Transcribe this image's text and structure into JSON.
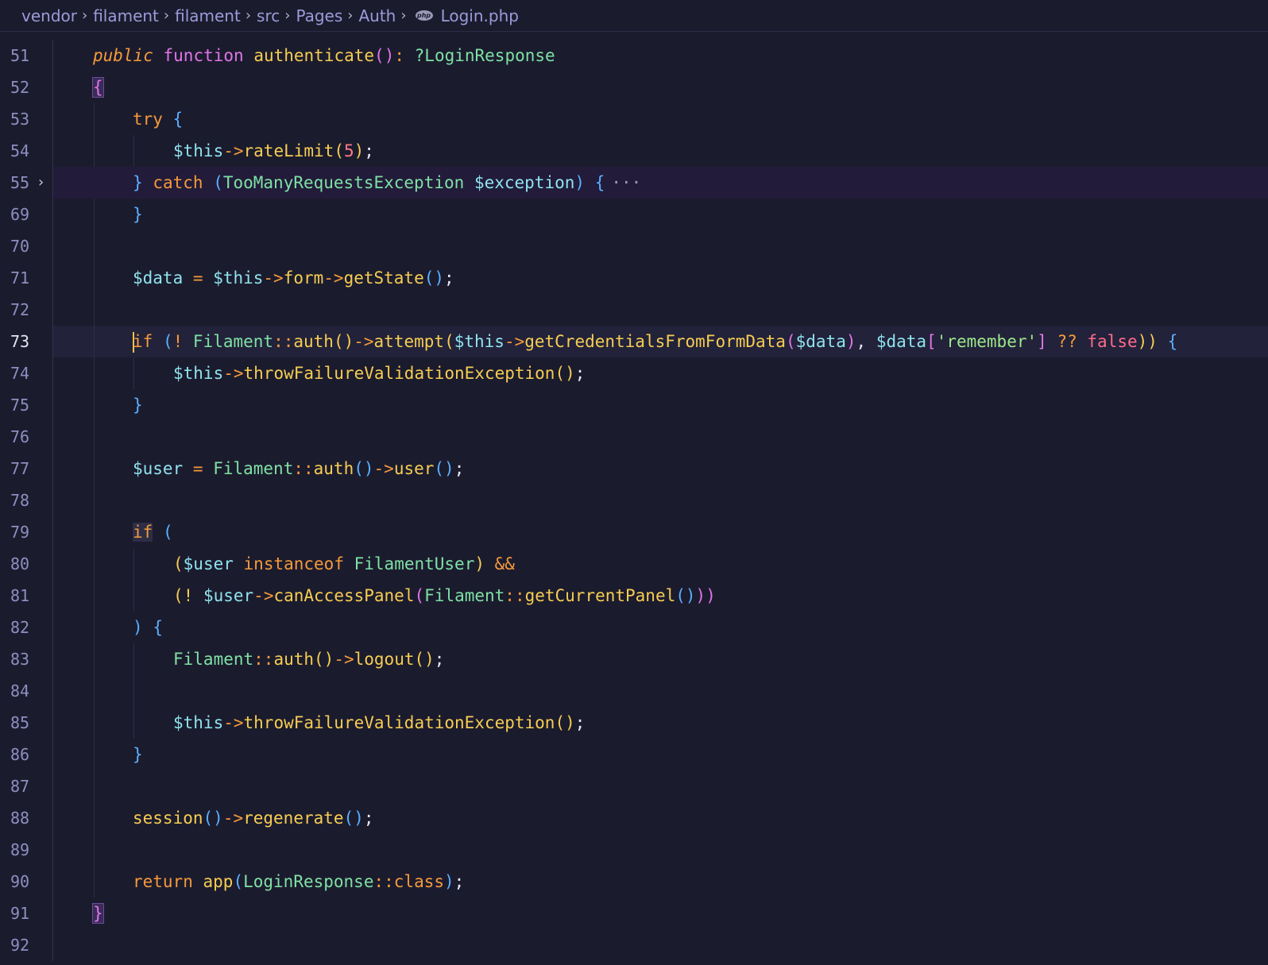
{
  "breadcrumb": {
    "items": [
      "vendor",
      "filament",
      "filament",
      "src",
      "Pages",
      "Auth"
    ],
    "file_badge": "php",
    "file": "Login.php"
  },
  "lines": {
    "l51": {
      "num": "51",
      "t1": "public",
      "t2": "function",
      "t3": "authenticate",
      "t4": "()",
      "t5": ":",
      "t6": "?LoginResponse"
    },
    "l52": {
      "num": "52",
      "t1": "{"
    },
    "l53": {
      "num": "53",
      "t1": "try",
      "t2": "{"
    },
    "l54": {
      "num": "54",
      "t1": "$this",
      "t2": "->",
      "t3": "rateLimit",
      "t4": "(",
      "t5": "5",
      "t6": ")",
      "t7": ";"
    },
    "l55": {
      "num": "55",
      "t1": "}",
      "t2": "catch",
      "t3": "(",
      "t4": "TooManyRequestsException",
      "t5": "$exception",
      "t6": ")",
      "t7": "{",
      "ellipsis": "···"
    },
    "l69": {
      "num": "69",
      "t1": "}"
    },
    "l70": {
      "num": "70"
    },
    "l71": {
      "num": "71",
      "t1": "$data",
      "t2": "=",
      "t3": "$this",
      "t4": "->",
      "t5": "form",
      "t6": "->",
      "t7": "getState",
      "t8": "()",
      "t9": ";"
    },
    "l72": {
      "num": "72"
    },
    "l73": {
      "num": "73",
      "t1": "if",
      "t2": "(",
      "t3": "!",
      "t4": "Filament",
      "t5": "::",
      "t6": "auth",
      "t7": "()",
      "t8": "->",
      "t9": "attempt",
      "t10": "(",
      "t11": "$this",
      "t12": "->",
      "t13": "getCredentialsFromFormData",
      "t14": "(",
      "t15": "$data",
      "t16": ")",
      "t17": ",",
      "t18": "$data",
      "t19": "[",
      "t20": "'remember'",
      "t21": "]",
      "t22": "??",
      "t23": "false",
      "t24": "))",
      "t25": "{"
    },
    "l74": {
      "num": "74",
      "t1": "$this",
      "t2": "->",
      "t3": "throwFailureValidationException",
      "t4": "()",
      "t5": ";"
    },
    "l75": {
      "num": "75",
      "t1": "}"
    },
    "l76": {
      "num": "76"
    },
    "l77": {
      "num": "77",
      "t1": "$user",
      "t2": "=",
      "t3": "Filament",
      "t4": "::",
      "t5": "auth",
      "t6": "()",
      "t7": "->",
      "t8": "user",
      "t9": "()",
      "t10": ";"
    },
    "l78": {
      "num": "78"
    },
    "l79": {
      "num": "79",
      "t1": "if",
      "t2": "("
    },
    "l80": {
      "num": "80",
      "t1": "(",
      "t2": "$user",
      "t3": "instanceof",
      "t4": "FilamentUser",
      "t5": ")",
      "t6": "&&"
    },
    "l81": {
      "num": "81",
      "t1": "(!",
      "t2": "$user",
      "t3": "->",
      "t4": "canAccessPanel",
      "t5": "(",
      "t6": "Filament",
      "t7": "::",
      "t8": "getCurrentPanel",
      "t9": "()",
      "t10": "))"
    },
    "l82": {
      "num": "82",
      "t1": ")",
      "t2": "{"
    },
    "l83": {
      "num": "83",
      "t1": "Filament",
      "t2": "::",
      "t3": "auth",
      "t4": "()",
      "t5": "->",
      "t6": "logout",
      "t7": "()",
      "t8": ";"
    },
    "l84": {
      "num": "84"
    },
    "l85": {
      "num": "85",
      "t1": "$this",
      "t2": "->",
      "t3": "throwFailureValidationException",
      "t4": "()",
      "t5": ";"
    },
    "l86": {
      "num": "86",
      "t1": "}"
    },
    "l87": {
      "num": "87"
    },
    "l88": {
      "num": "88",
      "t1": "session",
      "t2": "()",
      "t3": "->",
      "t4": "regenerate",
      "t5": "()",
      "t6": ";"
    },
    "l89": {
      "num": "89"
    },
    "l90": {
      "num": "90",
      "t1": "return",
      "t2": "app",
      "t3": "(",
      "t4": "LoginResponse",
      "t5": "::",
      "t6": "class",
      "t7": ")",
      "t8": ";"
    },
    "l91": {
      "num": "91",
      "t1": "}"
    },
    "l92": {
      "num": "92"
    }
  }
}
